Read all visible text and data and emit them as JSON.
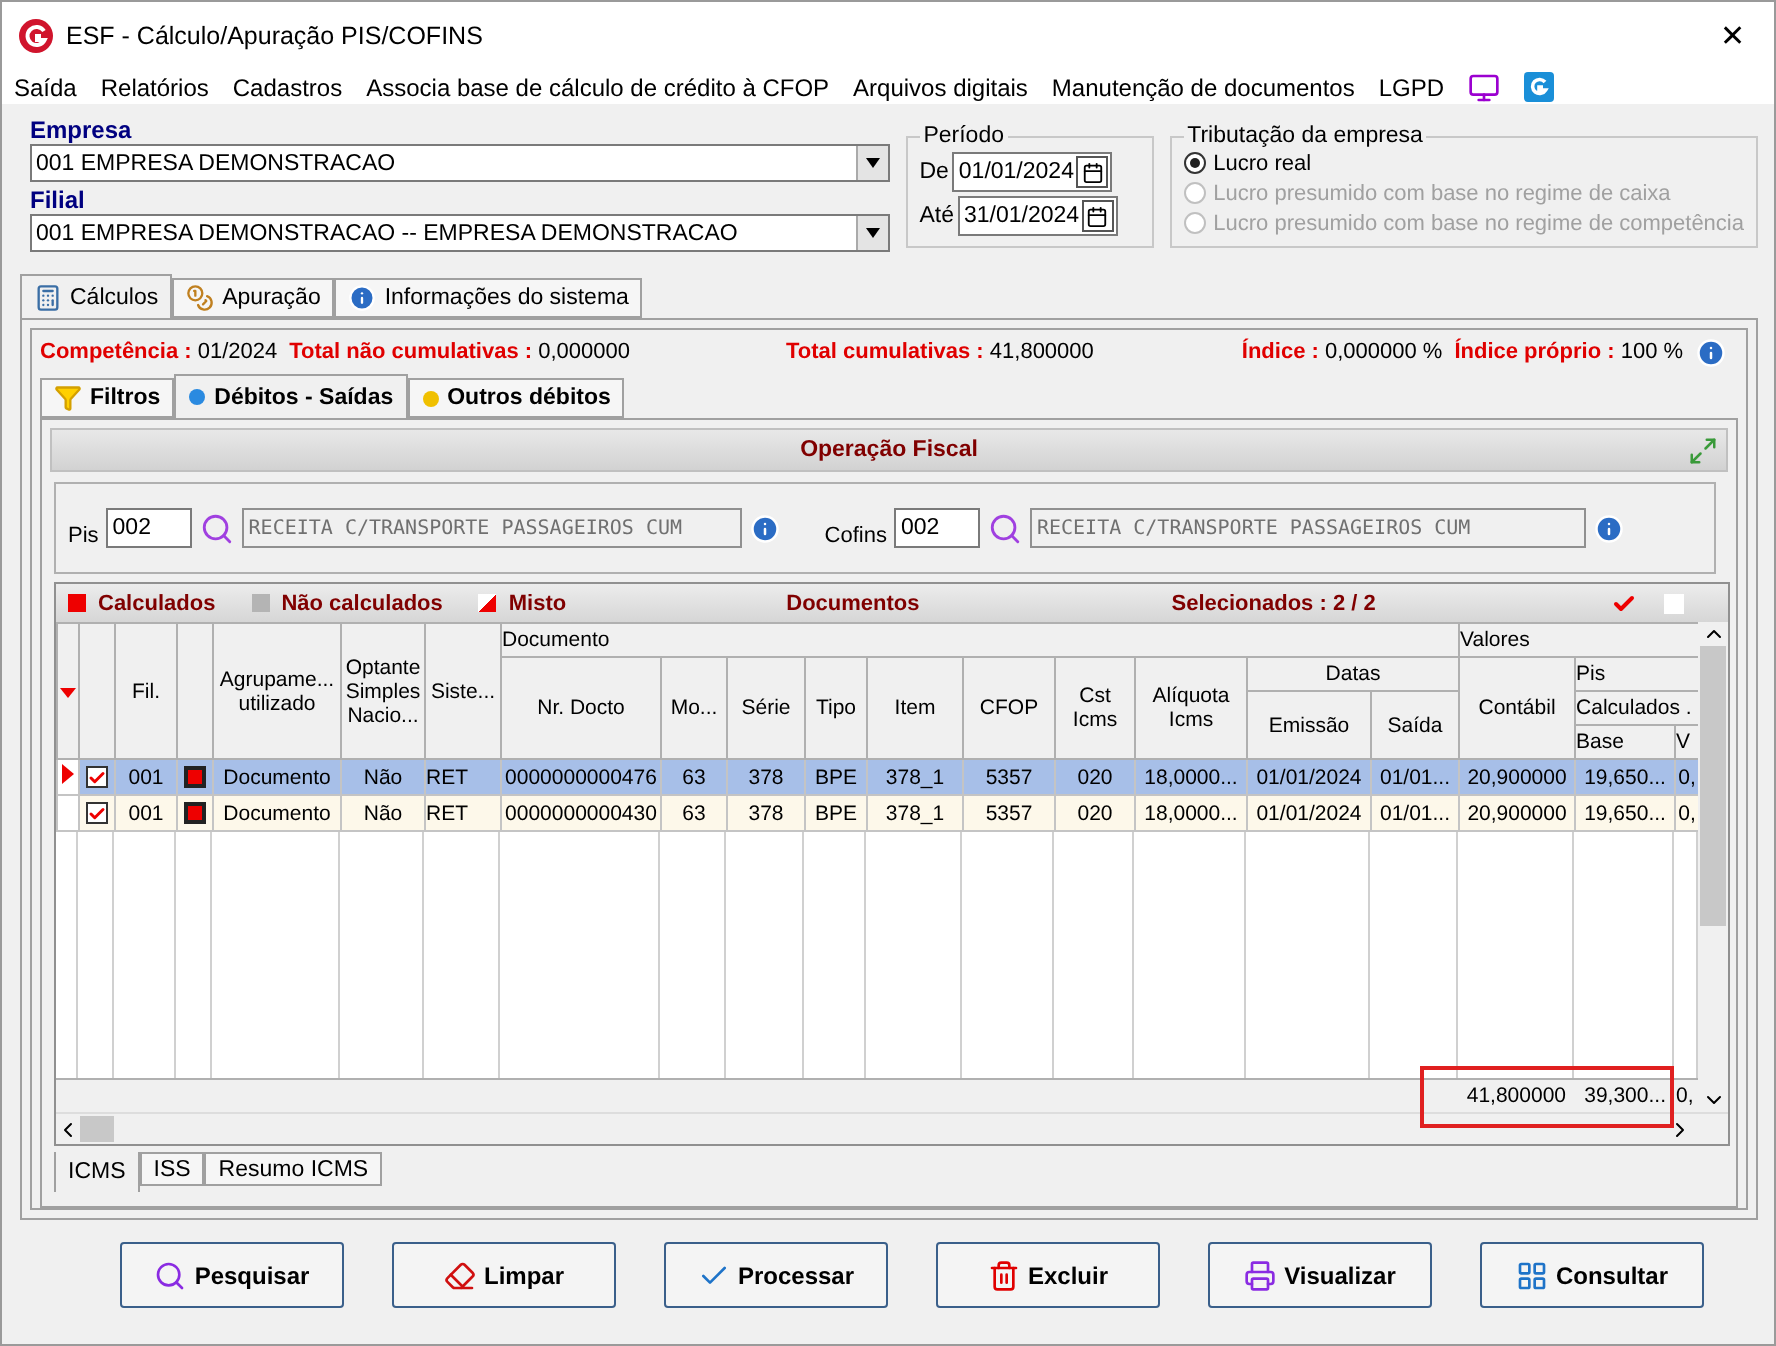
{
  "window": {
    "title": "ESF - Cálculo/Apuração PIS/COFINS",
    "close": "✕"
  },
  "menu": [
    "Saída",
    "Relatórios",
    "Cadastros",
    "Associa base de cálculo de crédito à CFOP",
    "Arquivos digitais",
    "Manutenção de documentos",
    "LGPD"
  ],
  "empresa": {
    "label": "Empresa",
    "value": "001 EMPRESA DEMONSTRACAO"
  },
  "filial": {
    "label": "Filial",
    "value": "001 EMPRESA DEMONSTRACAO -- EMPRESA DEMONSTRACAO"
  },
  "periodo": {
    "title": "Período",
    "de_label": "De",
    "de": "01/01/2024",
    "ate_label": "Até",
    "ate": "31/01/2024"
  },
  "tributacao": {
    "title": "Tributação da empresa",
    "options": [
      {
        "label": "Lucro real",
        "selected": true,
        "disabled": false
      },
      {
        "label": "Lucro presumido com base no regime de caixa",
        "selected": false,
        "disabled": true
      },
      {
        "label": "Lucro presumido com base no regime de competência",
        "selected": false,
        "disabled": true
      }
    ]
  },
  "main_tabs": [
    {
      "label": "Cálculos",
      "selected": true
    },
    {
      "label": "Apuração",
      "selected": false
    },
    {
      "label": "Informações do sistema",
      "selected": false
    }
  ],
  "summary": [
    {
      "label": "Competência :",
      "value": "01/2024"
    },
    {
      "label": "Total não cumulativas :",
      "value": "0,000000"
    },
    {
      "label": "Total cumulativas :",
      "value": "41,800000"
    },
    {
      "label": "Índice :",
      "value": "0,000000 %"
    },
    {
      "label": "Índice próprio :",
      "value": "100 %"
    }
  ],
  "sub_tabs": [
    {
      "label": "Filtros",
      "selected": false
    },
    {
      "label": "Débitos - Saídas",
      "selected": true
    },
    {
      "label": "Outros débitos",
      "selected": false
    }
  ],
  "operacao": {
    "title": "Operação Fiscal",
    "pis_label": "Pis",
    "pis_code": "002",
    "pis_desc": "RECEITA C/TRANSPORTE PASSAGEIROS CUM",
    "cofins_label": "Cofins",
    "cofins_code": "002",
    "cofins_desc": "RECEITA C/TRANSPORTE PASSAGEIROS CUM"
  },
  "legend": [
    {
      "label": "Calculados",
      "color": "#ee0000"
    },
    {
      "label": "Não calculados",
      "color": "#b4b4b4"
    },
    {
      "label": "Misto",
      "color": "#ee0000"
    }
  ],
  "grid_title": "Documentos",
  "selecionados": "Selecionados : 2 / 2",
  "header": {
    "documento": "Documento",
    "valores": "Valores",
    "datas": "Datas",
    "pis": "Pis",
    "calculados": "Calculados .",
    "columns": [
      "Fil.",
      "Agrupame...\nutilizado",
      "Optante\nSimples\nNacio...",
      "Siste...",
      "Nr. Docto",
      "Mo...",
      "Série",
      "Tipo",
      "Item",
      "CFOP",
      "Cst\nIcms",
      "Alíquota\nIcms",
      "Emissão",
      "Saída",
      "Contábil",
      "Base",
      "V"
    ]
  },
  "rows": [
    {
      "current": true,
      "checked": true,
      "color": "#ee0000",
      "cells": [
        "001",
        "Documento",
        "Não",
        "RET",
        "0000000000476",
        "63",
        "378",
        "BPE",
        "378_1",
        "5357",
        "020",
        "18,0000...",
        "01/01/2024",
        "01/01...",
        "20,900000",
        "19,650...",
        "0,"
      ]
    },
    {
      "current": false,
      "checked": true,
      "color": "#ee0000",
      "cells": [
        "001",
        "Documento",
        "Não",
        "RET",
        "0000000000430",
        "63",
        "378",
        "BPE",
        "378_1",
        "5357",
        "020",
        "18,0000...",
        "01/01/2024",
        "01/01...",
        "20,900000",
        "19,650...",
        "0,"
      ]
    }
  ],
  "totals": [
    "41,800000",
    "39,300...",
    "0,"
  ],
  "bottom_tabs": [
    {
      "label": "ICMS",
      "selected": true
    },
    {
      "label": "ISS",
      "selected": false
    },
    {
      "label": "Resumo ICMS",
      "selected": false
    }
  ],
  "buttons": [
    {
      "label": "Pesquisar",
      "kind": "search"
    },
    {
      "label": "Limpar",
      "kind": "clear"
    },
    {
      "label": "Processar",
      "kind": "process"
    },
    {
      "label": "Excluir",
      "kind": "delete"
    },
    {
      "label": "Visualizar",
      "kind": "print"
    },
    {
      "label": "Consultar",
      "kind": "query"
    }
  ]
}
